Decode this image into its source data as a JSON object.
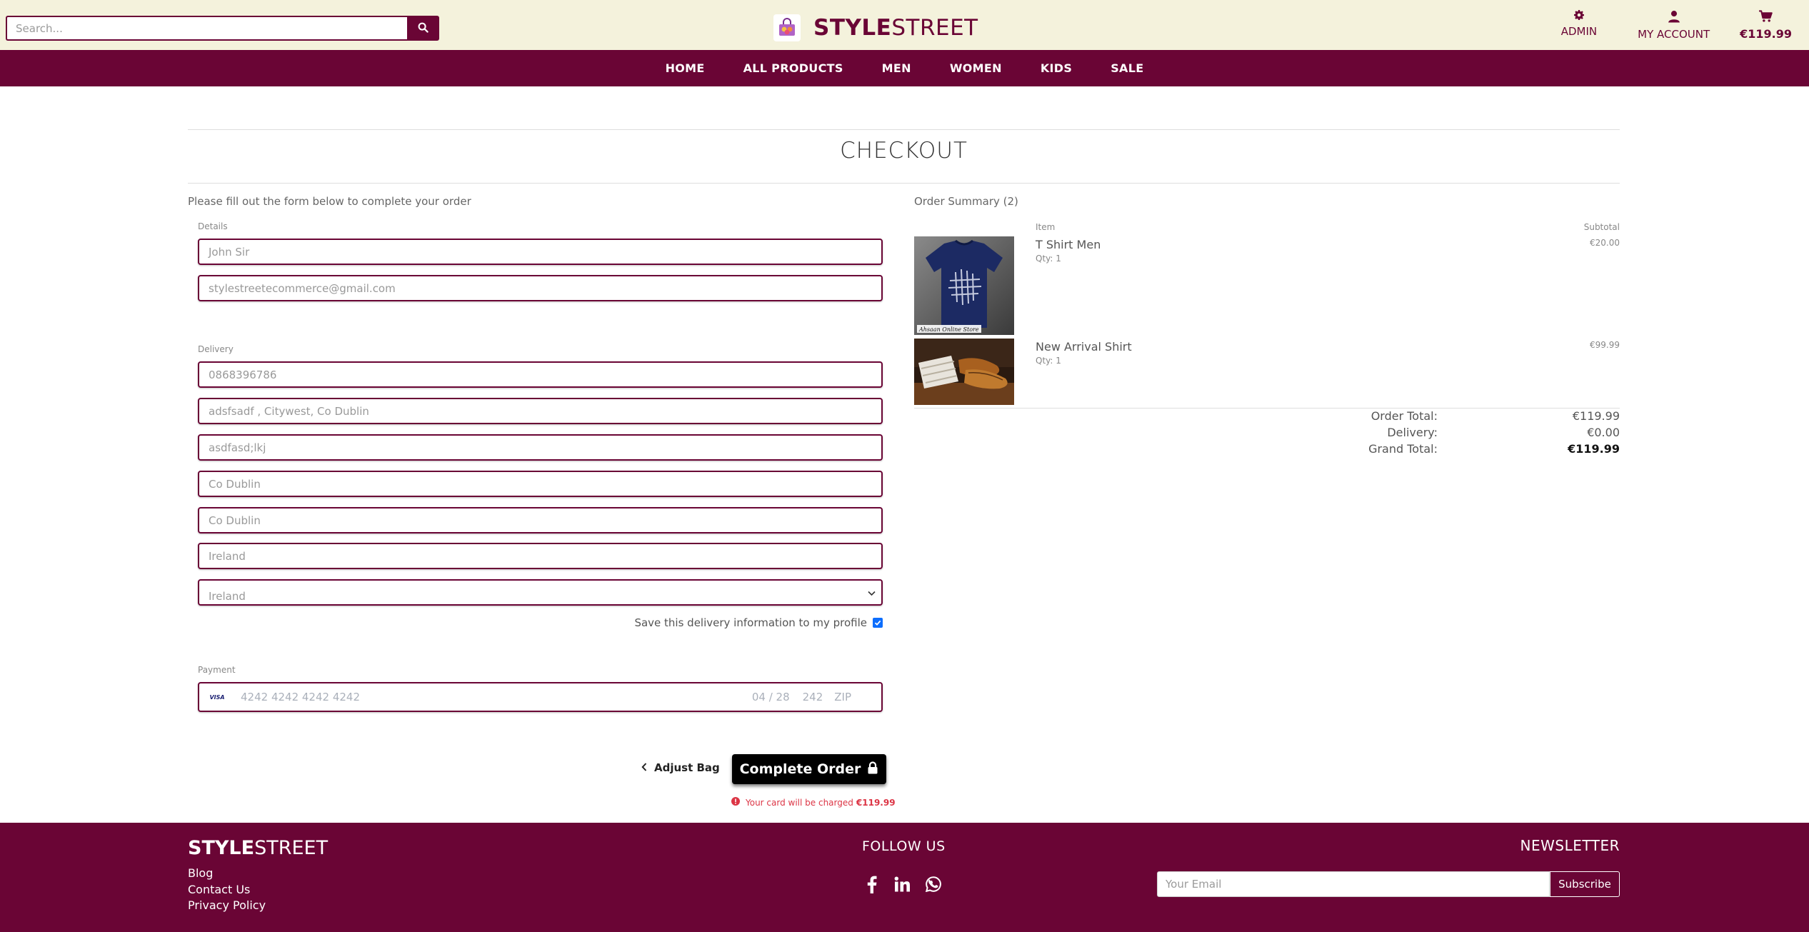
{
  "header": {
    "search_placeholder": "Search...",
    "brand_bold": "STYLE",
    "brand_light": "STREET",
    "admin_label": "ADMIN",
    "account_label": "MY ACCOUNT",
    "bag_total": "€119.99"
  },
  "nav": [
    "HOME",
    "ALL PRODUCTS",
    "MEN",
    "WOMEN",
    "KIDS",
    "SALE"
  ],
  "checkout": {
    "title": "CHECKOUT",
    "intro": "Please fill out the form below to complete your order",
    "details_label": "Details",
    "full_name": "John Sir",
    "email": "stylestreetecommerce@gmail.com",
    "delivery_label": "Delivery",
    "phone": "0868396786",
    "street1": "adsfsadf , Citywest, Co Dublin",
    "street2": "asdfasd;lkj",
    "town": "Co Dublin",
    "county": "Co Dublin",
    "postcode": "Ireland",
    "country": "Ireland",
    "save_info_label": "Save this delivery information to my profile",
    "payment_label": "Payment",
    "card_brand": "VISA",
    "card_number": "4242 4242 4242 4242",
    "card_exp": "04 / 28",
    "card_cvc": "242",
    "card_zip": "ZIP",
    "adjust_bag": "Adjust Bag",
    "complete_order": "Complete Order",
    "charge_note": "Your card will be charged",
    "charge_amount": "€119.99"
  },
  "order_summary": {
    "title": "Order Summary (2)",
    "item_header": "Item",
    "subtotal_header": "Subtotal",
    "items": [
      {
        "name": "T Shirt Men",
        "qty": "Qty: 1",
        "subtotal": "€20.00",
        "image_caption": "Ahsaan Online Store"
      },
      {
        "name": "New Arrival Shirt",
        "qty": "Qty: 1",
        "subtotal": "€99.99"
      }
    ],
    "order_total_label": "Order Total:",
    "order_total": "€119.99",
    "delivery_label": "Delivery:",
    "delivery": "€0.00",
    "grand_total_label": "Grand Total:",
    "grand_total": "€119.99"
  },
  "footer": {
    "brand_bold": "STYLE",
    "brand_light": "STREET",
    "links": [
      "Blog",
      "Contact Us",
      "Privacy Policy"
    ],
    "follow_us": "FOLLOW US",
    "newsletter": "NEWSLETTER",
    "email_placeholder": "Your Email",
    "subscribe": "Subscribe"
  },
  "colors": {
    "brand": "#6a0535",
    "header_bg": "#f4f2dc",
    "error": "#dc3545"
  }
}
